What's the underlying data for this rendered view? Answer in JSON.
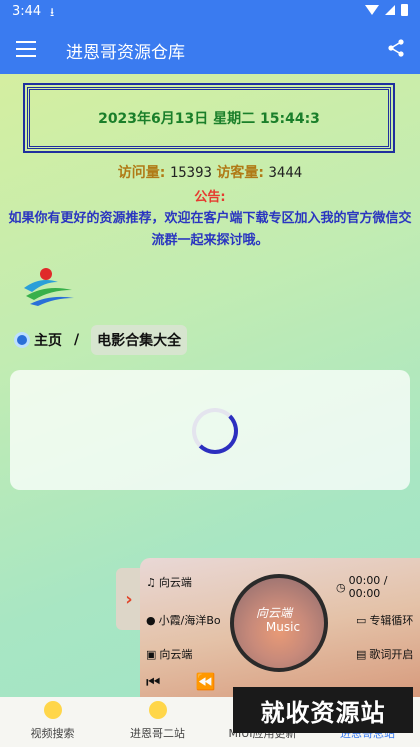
{
  "status_bar": {
    "time": "3:44",
    "download": "⭳"
  },
  "app_bar": {
    "title": "进恩哥资源仓库"
  },
  "clock": {
    "text": "2023年6月13日 星期二 15:44:3"
  },
  "stats": {
    "visits_label": "访问量:",
    "visits": "15393",
    "visitors_label": "访客量:",
    "visitors": "3444"
  },
  "notice": {
    "title": "公告:",
    "text": "如果你有更好的资源推荐，欢迎在客户端下载专区加入我的官方微信交流群一起来探讨哦。"
  },
  "breadcrumb": {
    "home": "主页",
    "separator": "/",
    "current": "电影合集大全"
  },
  "player": {
    "title": "向云端",
    "artist": "小霞/海洋Bo",
    "album": "向云端",
    "time": "00:00 / 00:00",
    "mode": "专辑循环",
    "lyrics": "歌词开启",
    "disc_label": "Music",
    "disc_script": "向云端",
    "toggle": "›"
  },
  "watermark": "就收资源站",
  "bottom_nav": [
    {
      "label": "视频搜索"
    },
    {
      "label": "进恩哥二站"
    },
    {
      "label": "MIUI应用更新"
    },
    {
      "label": "进恩哥总站"
    }
  ],
  "colors": {
    "primary": "#3a7bf0",
    "clock_text": "#1a7f2a",
    "notice_text": "#2a35c0",
    "notice_title": "#e63a2f"
  }
}
